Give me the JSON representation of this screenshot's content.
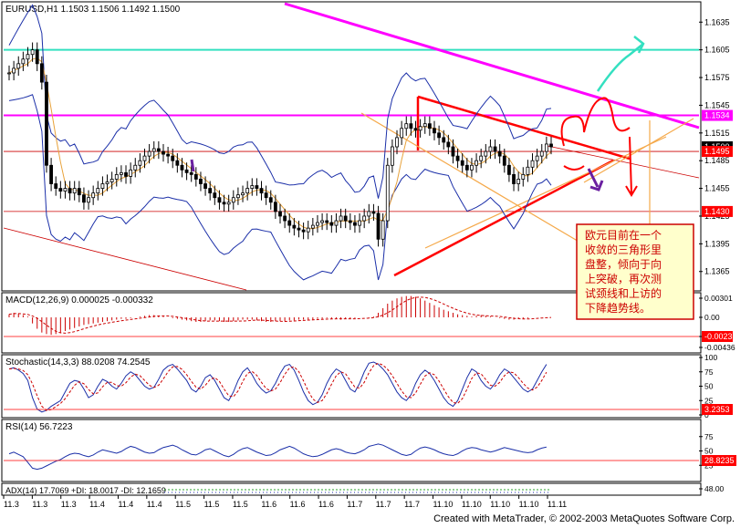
{
  "window": {
    "footer_text": "Created with MetaTrader, © 2002-2003 MetaQuotes Software Corp."
  },
  "colors": {
    "bg": "#ffffff",
    "grid": "#000000",
    "candle": "#000000",
    "bollinger": "#1b2fa8",
    "ma": "#e8a23a",
    "magenta": "#ff00ff",
    "cyan": "#33e0c0",
    "red": "#ff0000",
    "darkred": "#cc0000",
    "orange": "#f5a94a",
    "purple": "#6a1fa0",
    "note_bg": "#ffffcc",
    "note_border": "#cc0000",
    "label_red": "#ff0000",
    "macd_bar": "#cc0000",
    "osc_line": "#1b2fa8",
    "signal_line": "#cc0000"
  },
  "chart_data": [
    {
      "type": "candlestick",
      "title": "EURUSD,H1  1.1503 1.1506 1.1492 1.1500",
      "ylim": [
        1.1345,
        1.1655
      ],
      "y_ticks": [
        "1.1635",
        "1.1605",
        "1.1575",
        "1.1545",
        "1.1515",
        "1.1485",
        "1.1455",
        "1.1425",
        "1.1395",
        "1.1365"
      ],
      "price_labels": [
        {
          "text": "1.1534",
          "value": 1.1534,
          "color": "#ff00ff"
        },
        {
          "text": "1.1500",
          "value": 1.15,
          "color": "#000000"
        },
        {
          "text": "1.1495",
          "value": 1.1495,
          "color": "#ff0000"
        },
        {
          "text": "1.1430",
          "value": 1.143,
          "color": "#ff0000"
        }
      ],
      "close_series": [
        1.158,
        1.1585,
        1.159,
        1.1595,
        1.16,
        1.1605,
        1.159,
        1.157,
        1.148,
        1.146,
        1.1455,
        1.1452,
        1.1455,
        1.145,
        1.1455,
        1.1448,
        1.144,
        1.1445,
        1.145,
        1.1455,
        1.146,
        1.1462,
        1.1465,
        1.147,
        1.1472,
        1.1468,
        1.1475,
        1.148,
        1.1485,
        1.149,
        1.1495,
        1.1498,
        1.1495,
        1.1492,
        1.149,
        1.1485,
        1.148,
        1.1475,
        1.1472,
        1.147,
        1.1465,
        1.146,
        1.1455,
        1.145,
        1.1445,
        1.144,
        1.1438,
        1.144,
        1.1445,
        1.1448,
        1.145,
        1.1455,
        1.1458,
        1.1455,
        1.145,
        1.1445,
        1.144,
        1.143,
        1.1425,
        1.142,
        1.1415,
        1.1412,
        1.141,
        1.1408,
        1.1412,
        1.1415,
        1.1418,
        1.142,
        1.1418,
        1.1415,
        1.142,
        1.1425,
        1.142,
        1.1418,
        1.1415,
        1.142,
        1.1425,
        1.143,
        1.1428,
        1.14,
        1.142,
        1.148,
        1.15,
        1.151,
        1.152,
        1.1525,
        1.152,
        1.1518,
        1.1522,
        1.1525,
        1.152,
        1.1515,
        1.151,
        1.1505,
        1.15,
        1.149,
        1.1485,
        1.148,
        1.1475,
        1.148,
        1.1485,
        1.149,
        1.1495,
        1.15,
        1.1495,
        1.149,
        1.148,
        1.147,
        1.146,
        1.1465,
        1.147,
        1.1478,
        1.1485,
        1.149,
        1.1495,
        1.1503,
        1.15
      ],
      "annotation_text": [
        "欧元目前在一个",
        "收敛的三角形里",
        "盘整，倾向于向",
        "上突破，再次测",
        "试颈线和上访的",
        "下降趋势线。"
      ]
    },
    {
      "type": "bar",
      "title": "MACD(12,26,9)  0.000025 -0.000332",
      "y_ticks": [
        "0.00301",
        "0.00",
        "-0.0023",
        "-0.00436"
      ],
      "values": [
        0.0004,
        0.0006,
        0.0005,
        0.0003,
        0.0001,
        -0.0008,
        -0.0015,
        -0.002,
        -0.0022,
        -0.0023,
        -0.0022,
        -0.002,
        -0.0018,
        -0.0016,
        -0.0014,
        -0.0012,
        -0.001,
        -0.0009,
        -0.0008,
        -0.0007,
        -0.0006,
        -0.0005,
        -0.0004,
        -0.0003,
        -0.0002,
        -0.0002,
        -0.0001,
        0.0,
        0.0001,
        0.0002,
        0.0003,
        0.0003,
        0.0002,
        0.0001,
        0.0,
        -0.0001,
        -0.0002,
        -0.0003,
        -0.0004,
        -0.0005,
        -0.0006,
        -0.0006,
        -0.0005,
        -0.0004,
        -0.0004,
        -0.0005,
        -0.0006,
        -0.0006,
        -0.0005,
        -0.0004,
        -0.0003,
        -0.0003,
        -0.0003,
        -0.0004,
        -0.0005,
        -0.0006,
        -0.0006,
        -0.0005,
        -0.0005,
        -0.0005,
        -0.0004,
        -0.0004,
        -0.0003,
        -0.0003,
        -0.0003,
        -0.0003,
        -0.0002,
        -0.0002,
        -0.0001,
        -0.0002,
        -0.0002,
        -0.0003,
        -0.0002,
        -0.0002,
        -0.0001,
        0.0,
        0.0,
        -0.0001,
        0.0001,
        0.0006,
        0.0012,
        0.0018,
        0.0022,
        0.0025,
        0.0027,
        0.0028,
        0.0028,
        0.0027,
        0.0025,
        0.0022,
        0.0019,
        0.0016,
        0.0013,
        0.001,
        0.0008,
        0.0006,
        0.0004,
        0.0003,
        0.0002,
        0.0001,
        0.0002,
        0.0003,
        0.0002,
        0.0001,
        0.0,
        -0.0001,
        -0.0002,
        -0.0003,
        -0.0003,
        -0.0002,
        -0.0002,
        -0.0001,
        0.0,
        0.0,
        0.0,
        0.0,
        0.0
      ]
    },
    {
      "type": "line",
      "title": "Stochastic(14,3,3)  88.0208  74.2545",
      "y_ticks": [
        "100",
        "75",
        "50",
        "25",
        "0"
      ],
      "red_label": "3.2353",
      "ylim": [
        0,
        100
      ],
      "values": [
        80,
        82,
        78,
        72,
        60,
        30,
        10,
        5,
        8,
        15,
        20,
        25,
        40,
        55,
        60,
        58,
        45,
        30,
        35,
        50,
        62,
        58,
        50,
        45,
        55,
        68,
        75,
        70,
        60,
        50,
        45,
        48,
        62,
        78,
        85,
        88,
        80,
        70,
        60,
        45,
        40,
        50,
        65,
        70,
        60,
        45,
        30,
        25,
        40,
        60,
        75,
        82,
        70,
        55,
        45,
        38,
        42,
        55,
        72,
        85,
        88,
        78,
        60,
        40,
        25,
        18,
        22,
        35,
        55,
        70,
        80,
        75,
        60,
        45,
        40,
        55,
        75,
        90,
        92,
        88,
        80,
        70,
        55,
        40,
        30,
        25,
        35,
        55,
        70,
        78,
        72,
        60,
        45,
        30,
        20,
        15,
        25,
        45,
        65,
        80,
        75,
        60,
        50,
        45,
        55,
        70,
        80,
        75,
        65,
        55,
        45,
        40,
        45,
        60,
        75,
        88
      ]
    },
    {
      "type": "line",
      "title": "RSI(14)  56.7223",
      "y_ticks": [
        "75",
        "50",
        "25"
      ],
      "red_label": "28.8235",
      "ylim": [
        0,
        100
      ],
      "values": [
        45,
        48,
        44,
        40,
        30,
        20,
        18,
        20,
        24,
        28,
        32,
        35,
        40,
        44,
        46,
        45,
        42,
        40,
        43,
        48,
        52,
        50,
        48,
        46,
        49,
        54,
        58,
        56,
        52,
        48,
        46,
        47,
        52,
        56,
        58,
        60,
        57,
        52,
        48,
        44,
        43,
        47,
        52,
        54,
        50,
        46,
        42,
        40,
        44,
        50,
        54,
        56,
        52,
        48,
        45,
        42,
        43,
        47,
        52,
        55,
        58,
        55,
        50,
        45,
        42,
        40,
        41,
        44,
        48,
        52,
        54,
        52,
        48,
        46,
        45,
        48,
        52,
        58,
        60,
        62,
        60,
        56,
        52,
        48,
        44,
        42,
        44,
        50,
        55,
        57,
        55,
        52,
        48,
        45,
        43,
        42,
        45,
        50,
        54,
        56,
        55,
        52,
        50,
        48,
        50,
        53,
        56,
        54,
        52,
        50,
        48,
        47,
        48,
        52,
        55,
        56.7
      ]
    },
    {
      "type": "line",
      "title": "ADX(14) 17.7069 +DI: 18.0017 -DI: 12.1659",
      "y_ticks": [
        "48.00"
      ],
      "x_tick_labels": [
        "11.3",
        "11.3",
        "11.3",
        "11.4",
        "11.4",
        "11.4",
        "11.5",
        "11.5",
        "11.5",
        "11.6",
        "11.6",
        "11.6",
        "11.7",
        "11.7",
        "11.7",
        "11.10",
        "11.10",
        "11.10",
        "11.10",
        "11.11"
      ]
    }
  ]
}
